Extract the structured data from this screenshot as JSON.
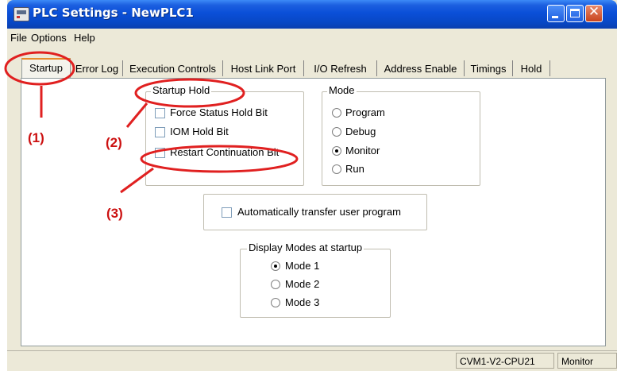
{
  "window": {
    "title": "PLC Settings - NewPLC1"
  },
  "menu": [
    "File",
    "Options",
    "Help"
  ],
  "tabs": [
    {
      "label": "Startup",
      "active": true
    },
    {
      "label": "Error Log"
    },
    {
      "label": "Execution Controls"
    },
    {
      "label": "Host Link Port"
    },
    {
      "label": "I/O Refresh"
    },
    {
      "label": "Address Enable"
    },
    {
      "label": "Timings"
    },
    {
      "label": "Hold"
    }
  ],
  "startup_hold": {
    "title": "Startup Hold",
    "options": [
      {
        "label": "Force Status Hold Bit",
        "checked": false
      },
      {
        "label": "IOM Hold Bit",
        "checked": false
      },
      {
        "label": "Restart Continuation Bit",
        "checked": false
      }
    ]
  },
  "mode": {
    "title": "Mode",
    "options": [
      {
        "label": "Program",
        "selected": false
      },
      {
        "label": "Debug",
        "selected": false
      },
      {
        "label": "Monitor",
        "selected": true
      },
      {
        "label": "Run",
        "selected": false
      }
    ]
  },
  "auto_transfer": {
    "label": "Automatically transfer user program",
    "checked": false
  },
  "display_modes": {
    "title": "Display Modes at startup",
    "options": [
      {
        "label": "Mode 1",
        "selected": true
      },
      {
        "label": "Mode 2",
        "selected": false
      },
      {
        "label": "Mode 3",
        "selected": false
      }
    ]
  },
  "status": {
    "cpu": "CVM1-V2-CPU21",
    "mode": "Monitor"
  },
  "annotations": [
    "(1)",
    "(2)",
    "(3)"
  ],
  "colors": {
    "title_bar": "#0a4fd8",
    "annotation": "#e02020",
    "close_button": "#c8431d"
  }
}
